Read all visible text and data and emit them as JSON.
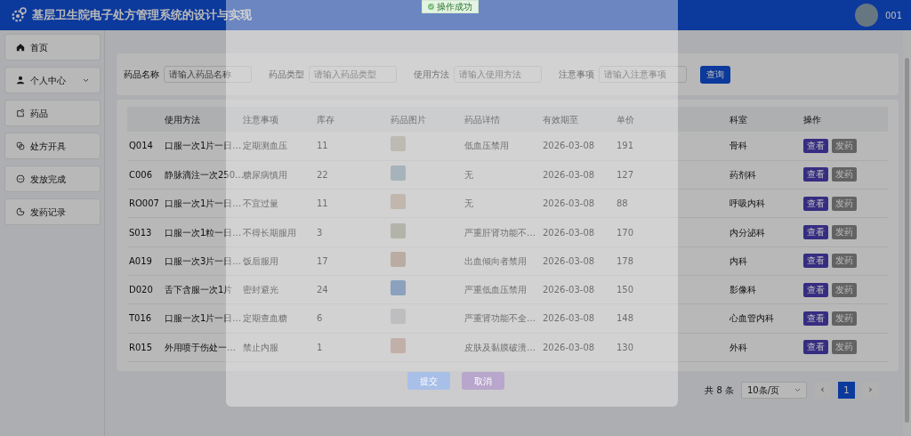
{
  "header": {
    "title": "基层卫生院电子处方管理系统的设计与实现",
    "user": "001"
  },
  "sidebar": {
    "items": [
      {
        "label": "首页",
        "expandable": false
      },
      {
        "label": "个人中心",
        "expandable": true
      },
      {
        "label": "药品",
        "expandable": false
      },
      {
        "label": "处方开具",
        "expandable": false
      },
      {
        "label": "发放完成",
        "expandable": false
      },
      {
        "label": "发药记录",
        "expandable": false
      }
    ]
  },
  "filters": [
    {
      "label": "药品名称",
      "placeholder": "请输入药品名称"
    },
    {
      "label": "药品类型",
      "placeholder": "请输入药品类型"
    },
    {
      "label": "使用方法",
      "placeholder": "请输入使用方法"
    },
    {
      "label": "注意事项",
      "placeholder": "请输入注意事项"
    }
  ],
  "search_button": "查询",
  "table": {
    "columns": [
      "",
      "使用方法",
      "注意事项",
      "库存",
      "药品图片",
      "药品详情",
      "有效期至",
      "单价",
      "科室",
      "操作"
    ],
    "rows": [
      {
        "cells": [
          "Q014",
          "口服一次1片一日…",
          "定期测血压",
          "11",
          "",
          "低血压禁用",
          "2026-03-08",
          "191",
          "骨科"
        ],
        "actions": [
          "查看",
          "发药"
        ]
      },
      {
        "cells": [
          "C006",
          "静脉滴注一次250…",
          "糖尿病慎用",
          "22",
          "",
          "无",
          "2026-03-08",
          "127",
          "药剂科"
        ],
        "actions": [
          "查看",
          "发药"
        ]
      },
      {
        "cells": [
          "RO007",
          "口服一次1片一日…",
          "不宜过量",
          "11",
          "",
          "无",
          "2026-03-08",
          "88",
          "呼吸内科"
        ],
        "actions": [
          "查看",
          "发药"
        ]
      },
      {
        "cells": [
          "S013",
          "口服一次1粒一日…",
          "不得长期服用",
          "3",
          "",
          "严重肝肾功能不…",
          "2026-03-08",
          "170",
          "内分泌科"
        ],
        "actions": [
          "查看",
          "发药"
        ]
      },
      {
        "cells": [
          "A019",
          "口服一次3片一日…",
          "饭后服用",
          "17",
          "",
          "出血倾向者禁用",
          "2026-03-08",
          "178",
          "内科"
        ],
        "actions": [
          "查看",
          "发药"
        ]
      },
      {
        "cells": [
          "D020",
          "舌下含服一次1片",
          "密封避光",
          "24",
          "",
          "严重低血压禁用",
          "2026-03-08",
          "150",
          "影像科"
        ],
        "actions": [
          "查看",
          "发药"
        ]
      },
      {
        "cells": [
          "T016",
          "口服一次1片一日…",
          "定期查血糖",
          "6",
          "",
          "严重肾功能不全…",
          "2026-03-08",
          "148",
          "心血管内科"
        ],
        "actions": [
          "查看",
          "发药"
        ]
      },
      {
        "cells": [
          "R015",
          "外用喷于伤处一…",
          "禁止内服",
          "1",
          "",
          "皮肤及黏膜破溃…",
          "2026-03-08",
          "130",
          "外科"
        ],
        "actions": [
          "查看",
          "发药"
        ]
      }
    ]
  },
  "pagination": {
    "total": "共 8 条",
    "page_size": "10条/页",
    "prev": "‹",
    "pages": [
      {
        "label": "1",
        "selected": true
      }
    ],
    "next": "›"
  },
  "toast": {
    "text": "操作成功"
  },
  "modal": {
    "buttons": [
      {
        "label": "提交",
        "kind": "primary"
      },
      {
        "label": "取消",
        "kind": "secondary"
      }
    ]
  }
}
